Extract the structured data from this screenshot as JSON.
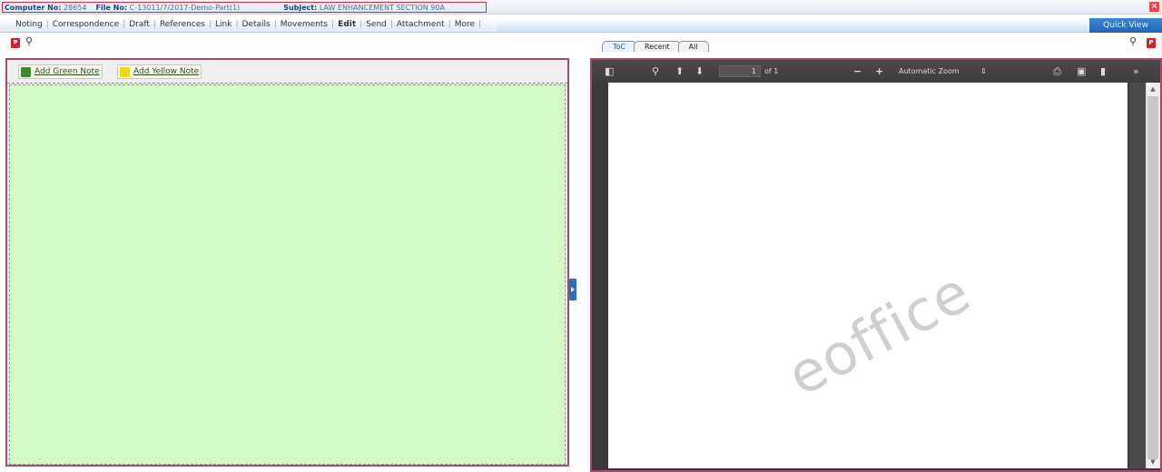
{
  "info": {
    "computer_no_label": "Computer No:",
    "computer_no": "28654",
    "file_no_label": "File No:",
    "file_no": "C-13011/7/2017-Demo-Part(1)",
    "subject_label": "Subject:",
    "subject": "LAW ENHANCEMENT SECTION 90A"
  },
  "menu": {
    "items": [
      "Noting",
      "Correspondence",
      "Draft",
      "References",
      "Link",
      "Details",
      "Movements",
      "Edit",
      "Send",
      "Attachment",
      "More"
    ],
    "quick_view": "Quick View"
  },
  "tabs": [
    "ToC",
    "Recent",
    "All"
  ],
  "notes": {
    "add_green": "Add Green Note",
    "add_yellow": "Add Yellow Note"
  },
  "pdf": {
    "page_current": "1",
    "page_of": "of 1",
    "zoom": "Automatic Zoom",
    "watermark": "eoffice"
  },
  "colors": {
    "note_area": "#d4fac7",
    "panel_border": "#a44a72",
    "quick_view": "#1e66b4"
  }
}
